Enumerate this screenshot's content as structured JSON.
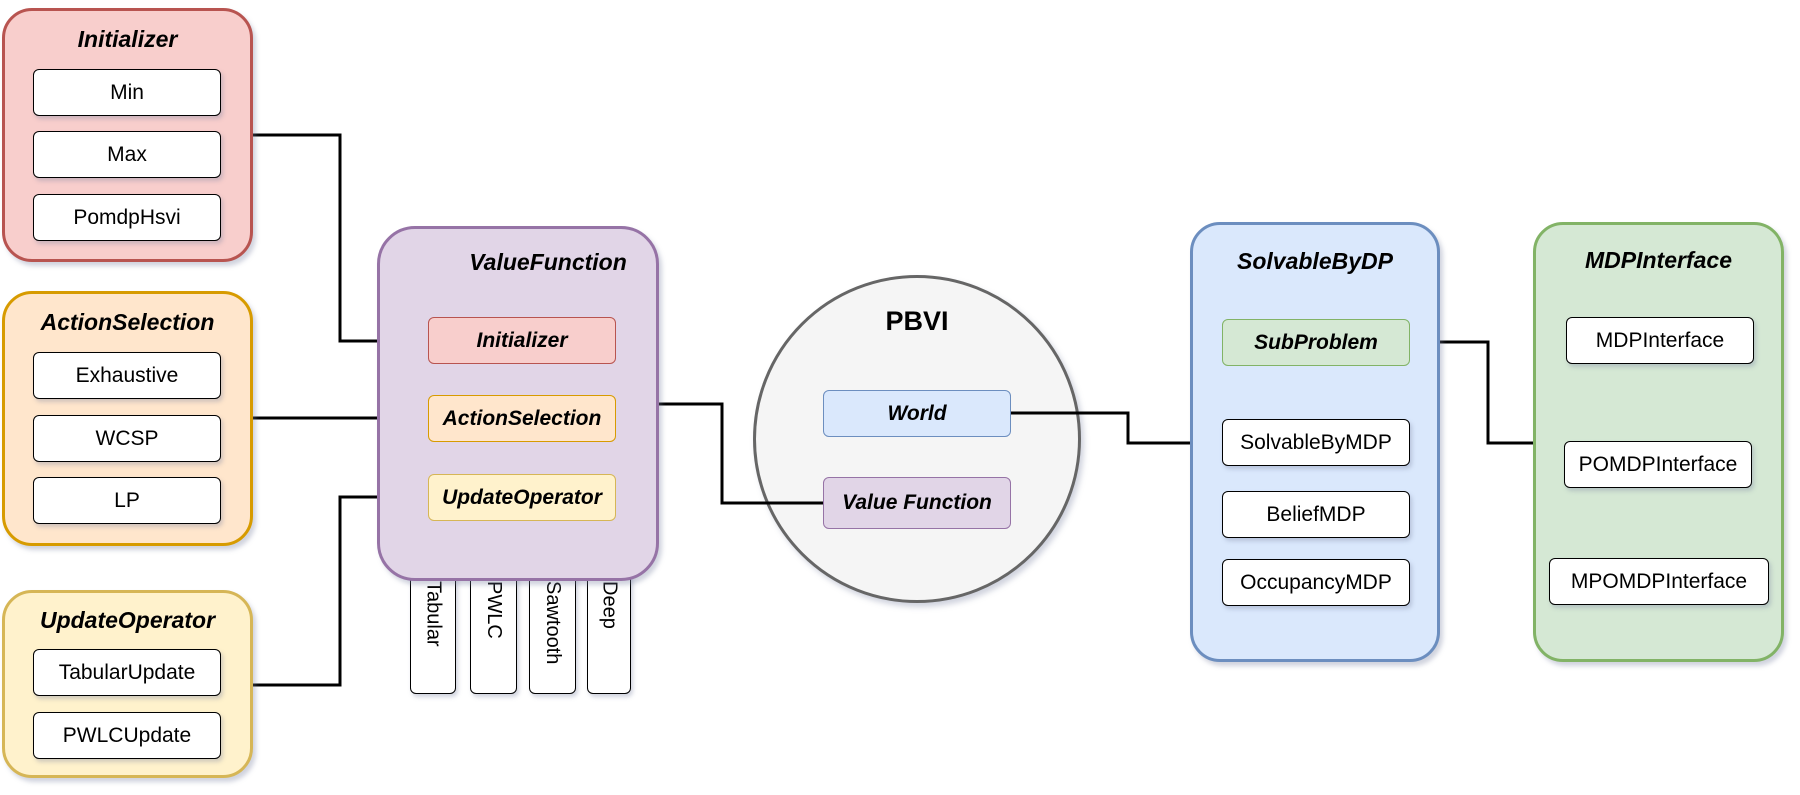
{
  "diagram": {
    "groups": {
      "initializer": {
        "title": "Initializer",
        "items": [
          "Min",
          "Max",
          "PomdpHsvi"
        ]
      },
      "action_selection": {
        "title": "ActionSelection",
        "items": [
          "Exhaustive",
          "WCSP",
          "LP"
        ]
      },
      "update_operator": {
        "title": "UpdateOperator",
        "items": [
          "TabularUpdate",
          "PWLCUpdate"
        ]
      },
      "value_function": {
        "title": "ValueFunction",
        "slots": [
          "Initializer",
          "ActionSelection",
          "UpdateOperator"
        ],
        "tabs": [
          "Tabular",
          "PWLC",
          "Sawtooth",
          "Deep"
        ]
      },
      "pbvi": {
        "title": "PBVI",
        "slots": [
          "World",
          "Value Function"
        ]
      },
      "solvable_by_dp": {
        "title": "SolvableByDP",
        "slot": "SubProblem",
        "items": [
          "SolvableByMDP",
          "BeliefMDP",
          "OccupancyMDP"
        ]
      },
      "mdp_interface": {
        "title": "MDPInterface",
        "items": [
          "MDPInterface",
          "POMDPInterface",
          "MPOMDPInterface"
        ]
      }
    },
    "colors": {
      "initializer": "#f8cecc",
      "action_selection": "#ffe6cc",
      "update_operator": "#fff2cc",
      "value_function": "#e1d5e7",
      "pbvi": "#f5f5f5",
      "solvable_by_dp": "#dae8fc",
      "mdp_interface": "#d5e8d4"
    },
    "connections": [
      [
        "Initializer",
        "ValueFunction.Initializer"
      ],
      [
        "ActionSelection",
        "ValueFunction.ActionSelection"
      ],
      [
        "UpdateOperator",
        "ValueFunction.UpdateOperator"
      ],
      [
        "ValueFunction",
        "PBVI.Value Function"
      ],
      [
        "PBVI.World",
        "SolvableByDP"
      ],
      [
        "SolvableByDP.SubProblem",
        "MDPInterface"
      ]
    ]
  }
}
